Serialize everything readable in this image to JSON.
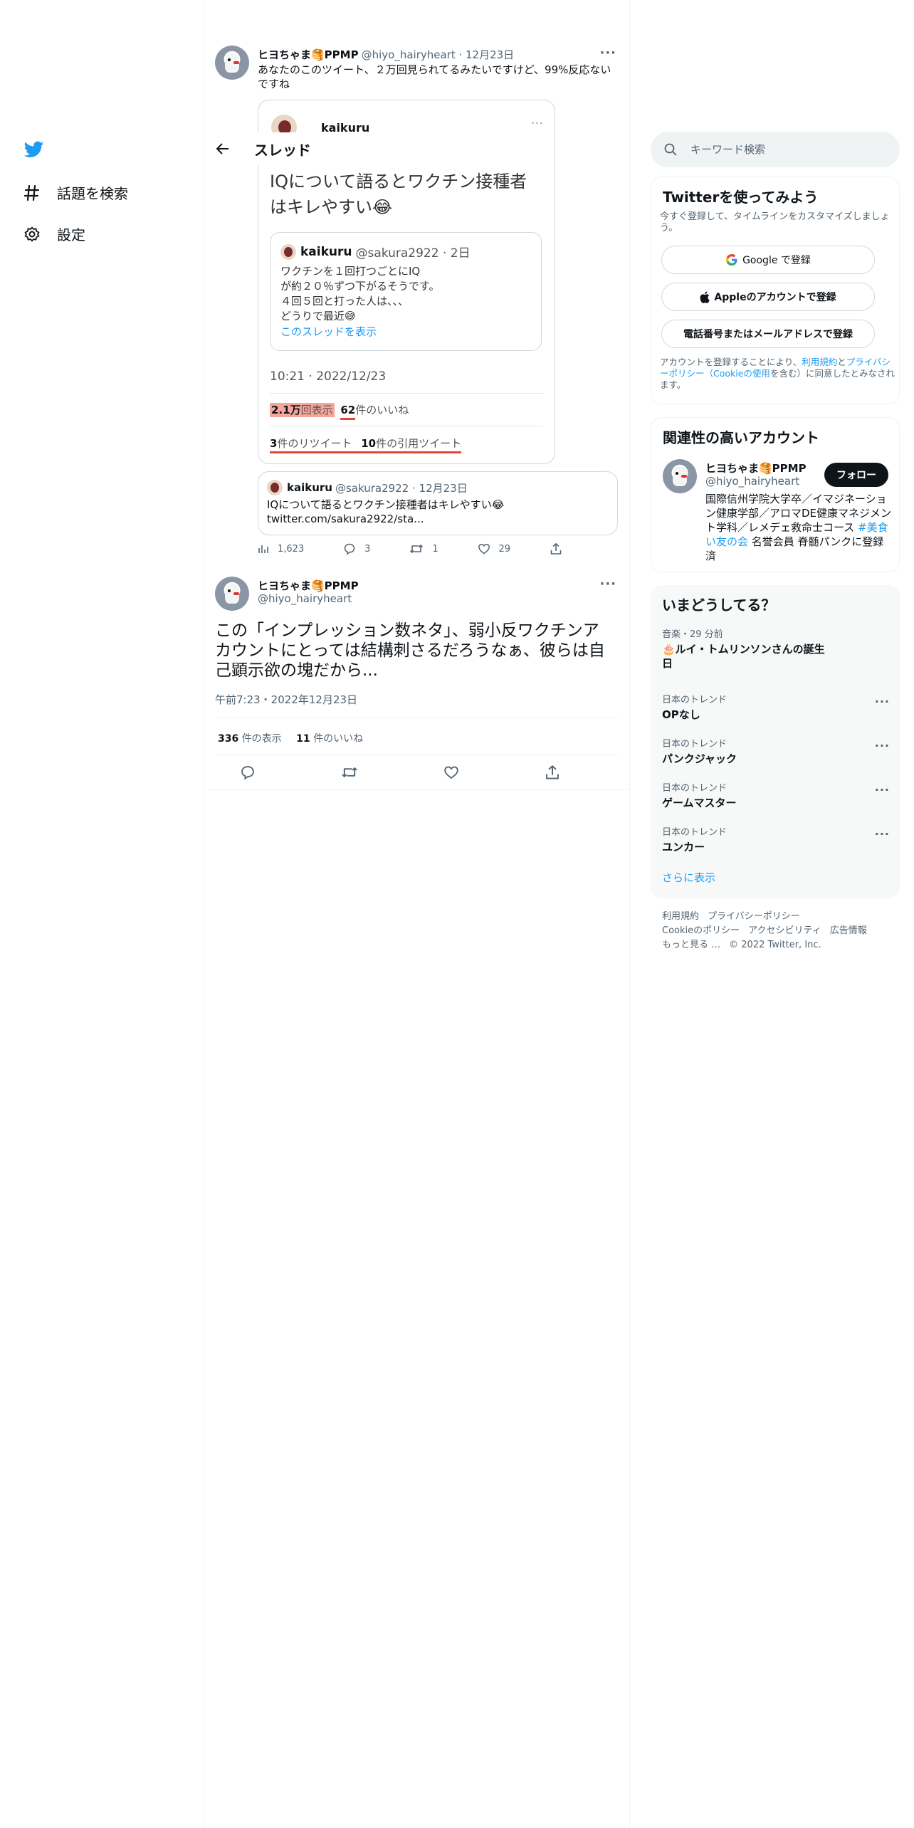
{
  "nav": {
    "explore_label": "話題を検索",
    "settings_label": "設定"
  },
  "thread_header": {
    "title": "スレッド"
  },
  "reply": {
    "name": "ヒヨちゃま🥞PPMP",
    "handle": "@hiyo_hairyheart · 12月23日",
    "text": "あなたのこのツイート、２万回見られてるみたいですけど、99%反応ないですね",
    "screenshot": {
      "author": "kaikuru",
      "text": "IQについて語るとワクチン接種者はキレやすい😂",
      "quote_name": "kaikuru",
      "quote_handle": "@sakura2922 · 2日",
      "quote_text": "ワクチンを１回打つごとにIQ\nが約２０％ずつ下がるそうです。\n４回５回と打った人は、、、\nどうりで最近😅",
      "quote_link": "このスレッドを表示",
      "time": "10:21 · 2022/12/23",
      "views_num": "2.1万",
      "views_label": "回表示",
      "likes_num": "62",
      "likes_label": "件のいいね",
      "rt_num": "3",
      "rt_label": "件のリツイート",
      "qt_num": "10",
      "qt_label": "件の引用ツイート"
    },
    "quote": {
      "name": "kaikuru",
      "handle": "@sakura2922 · 12月23日",
      "text": "IQについて語るとワクチン接種者はキレやすい😂",
      "link": "twitter.com/sakura2922/sta..."
    },
    "actions": {
      "views": "1,623",
      "replies": "3",
      "retweets": "1",
      "likes": "29"
    }
  },
  "main_tweet": {
    "name": "ヒヨちゃま🥞PPMP",
    "handle": "@hiyo_hairyheart",
    "text": "この「インプレッション数ネタ」、弱小反ワクチンアカウントにとっては結構刺さるだろうなぁ、彼らは自己顕示欲の塊だから...",
    "time": "午前7:23・2022年12月23日",
    "views_num": "336",
    "views_label": "件の表示",
    "likes_num": "11",
    "likes_label": "件のいいね"
  },
  "search": {
    "placeholder": "キーワード検索"
  },
  "signup": {
    "title": "Twitterを使ってみよう",
    "subtitle": "今すぐ登録して、タイムラインをカスタマイズしましょう。",
    "google_label": "Google で登録",
    "apple_label": "Appleのアカウントで登録",
    "phone_label": "電話番号またはメールアドレスで登録",
    "terms_pre": "アカウントを登録することにより、",
    "terms_link1": "利用規約",
    "terms_and": "と",
    "terms_link2": "プライバシーポリシー（Cookieの使用",
    "terms_post": "を含む）に同意したとみなされます。"
  },
  "relevant": {
    "title": "関連性の高いアカウント",
    "name": "ヒヨちゃま🥞PPMP",
    "handle": "@hiyo_hairyheart",
    "follow_label": "フォロー",
    "bio_pre": "国際信州学院大学卒／イマジネーション健康学部／アロマDE健康マネジメント学科／レメデェ救命士コース ",
    "bio_tag": "#美食い友の会",
    "bio_post": " 名誉会員 脊髄パンクに登録済"
  },
  "trends": {
    "title": "いまどうしてる？",
    "items": [
      {
        "meta": "音楽・29 分前",
        "name": "🎂ルイ・トムリンソンさんの誕生日"
      },
      {
        "meta": "日本のトレンド",
        "name": "OPなし"
      },
      {
        "meta": "日本のトレンド",
        "name": "パンクジャック"
      },
      {
        "meta": "日本のトレンド",
        "name": "ゲームマスター"
      },
      {
        "meta": "日本のトレンド",
        "name": "ユンカー"
      }
    ],
    "more": "さらに表示"
  },
  "footer": {
    "terms": "利用規約",
    "privacy": "プライバシーポリシー",
    "cookie": "Cookieのポリシー",
    "accessibility": "アクセシビリティ",
    "ads": "広告情報",
    "more": "もっと見る …",
    "copyright": "© 2022 Twitter, Inc."
  },
  "colors": {
    "accent": "#1d9bf0",
    "text": "#0f1419",
    "secondary": "#536471"
  }
}
